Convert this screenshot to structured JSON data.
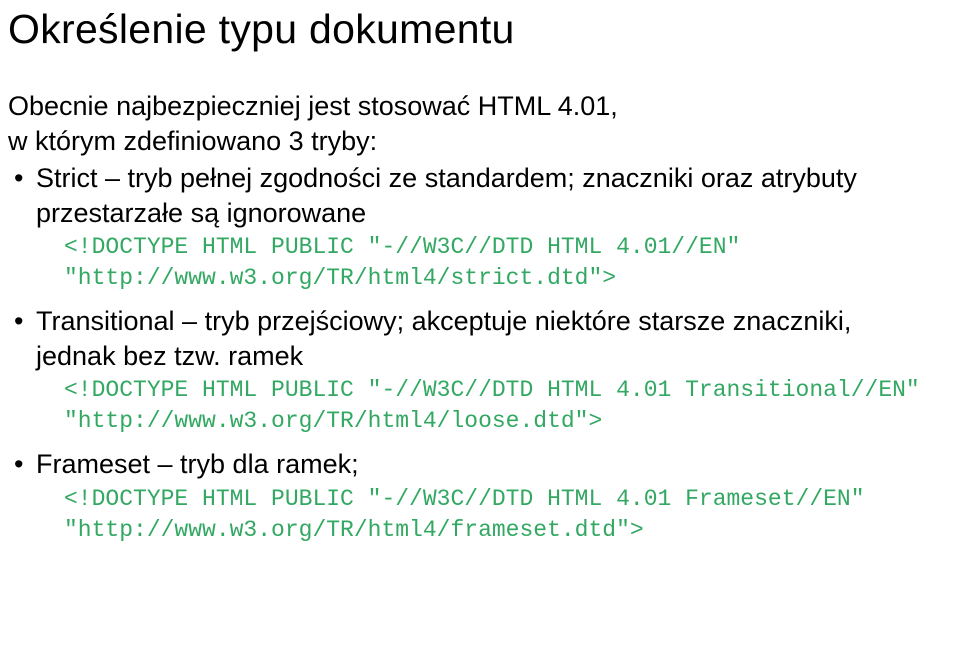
{
  "title": "Określenie typu dokumentu",
  "intro_line1": "Obecnie najbezpieczniej jest stosować HTML 4.01,",
  "intro_line2": "w którym zdefiniowano 3 tryby:",
  "items": [
    {
      "desc": "Strict – tryb pełnej zgodności ze standardem; znaczniki oraz atrybuty przestarzałe są ignorowane",
      "code": "<!DOCTYPE HTML PUBLIC \"-//W3C//DTD HTML 4.01//EN\"\n\"http://www.w3.org/TR/html4/strict.dtd\">"
    },
    {
      "desc": "Transitional – tryb przejściowy; akceptuje niektóre starsze znaczniki, jednak bez tzw. ramek",
      "code": "<!DOCTYPE HTML PUBLIC \"-//W3C//DTD HTML 4.01 Transitional//EN\"\n\"http://www.w3.org/TR/html4/loose.dtd\">"
    },
    {
      "desc": "Frameset – tryb dla ramek;",
      "code": "<!DOCTYPE HTML PUBLIC \"-//W3C//DTD HTML 4.01 Frameset//EN\"\n\"http://www.w3.org/TR/html4/frameset.dtd\">"
    }
  ]
}
